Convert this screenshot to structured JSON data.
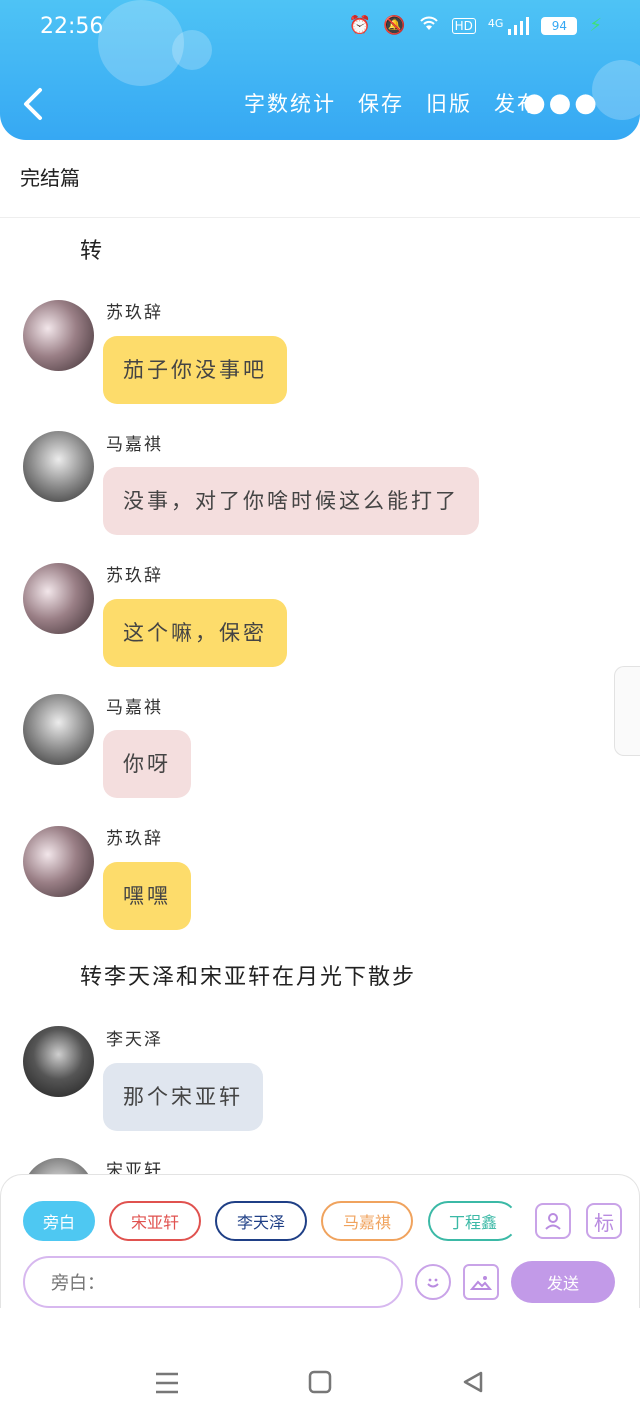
{
  "status_bar": {
    "time": "22:56",
    "network": "4G",
    "hd": "HD",
    "battery": "94",
    "icons": [
      "alarm-icon",
      "mute-icon",
      "wifi-icon",
      "hd-icon",
      "signal-icon",
      "battery-icon",
      "charging-icon"
    ]
  },
  "header": {
    "back_icon": "chevron-left-icon",
    "actions": [
      "字数统计",
      "保存",
      "旧版",
      "发布"
    ],
    "more_icon": "more-dots-icon",
    "colors": {
      "gradient_top": "#4ec3f5",
      "gradient_bottom": "#36a8f3"
    }
  },
  "title": "完结篇",
  "chat": {
    "narration_1": "转",
    "messages": [
      {
        "speaker": "苏玖辞",
        "text": "茄子你没事吧",
        "color": "#fddc6b"
      },
      {
        "speaker": "马嘉祺",
        "text": "没事，对了你啥时候这么能打了",
        "color": "#f4dede"
      },
      {
        "speaker": "苏玖辞",
        "text": "这个嘛，保密",
        "color": "#fddc6b"
      },
      {
        "speaker": "马嘉祺",
        "text": "你呀",
        "color": "#f4dede"
      },
      {
        "speaker": "苏玖辞",
        "text": "嘿嘿",
        "color": "#fddc6b"
      }
    ],
    "narration_2": "转李天泽和宋亚轩在月光下散步",
    "message_6": {
      "speaker": "李天泽",
      "text": "那个宋亚轩",
      "color": "#e0e6ef"
    },
    "message_7_speaker": "宋亚轩"
  },
  "character_chips": [
    {
      "label": "旁白",
      "color": "#4ec8f2",
      "filled": true
    },
    {
      "label": "宋亚轩",
      "color": "#e0524f",
      "filled": false
    },
    {
      "label": "李天泽",
      "color": "#1f3f86",
      "filled": false
    },
    {
      "label": "马嘉祺",
      "color": "#f0a35e",
      "filled": false
    },
    {
      "label": "丁程鑫",
      "color": "#3bb9a6",
      "filled": false
    }
  ],
  "input": {
    "placeholder": "旁白："
  },
  "send_label": "发送",
  "toolbar_icons": [
    "person-card-icon",
    "tag-icon",
    "emoji-icon",
    "image-icon"
  ],
  "tag_label": "标",
  "nav_icons": [
    "menu-icon",
    "home-square-icon",
    "back-triangle-icon"
  ]
}
